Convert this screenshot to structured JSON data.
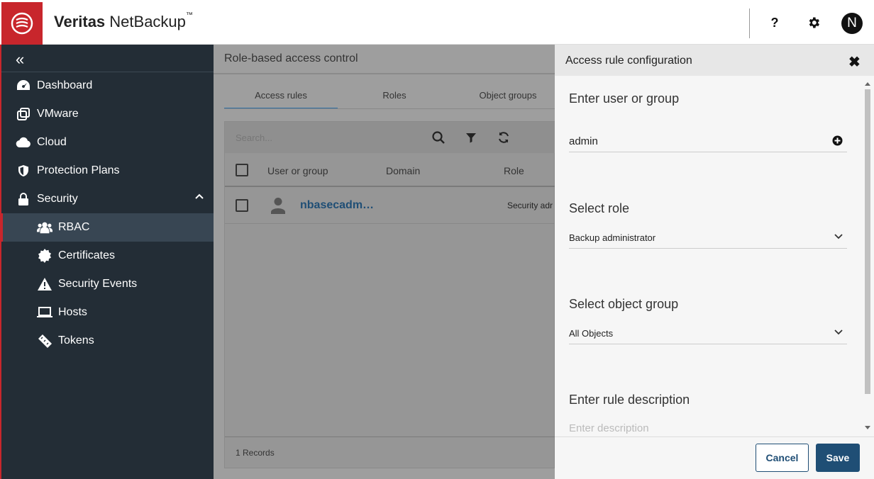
{
  "header": {
    "brand_bold": "Veritas",
    "brand_rest": " NetBackup",
    "trademark": "™",
    "help_label": "?",
    "avatar_initial": "N"
  },
  "sidebar": {
    "items": [
      {
        "label": "Dashboard",
        "icon": "dashboard-icon"
      },
      {
        "label": "VMware",
        "icon": "vmware-icon"
      },
      {
        "label": "Cloud",
        "icon": "cloud-icon"
      },
      {
        "label": "Protection Plans",
        "icon": "shield-icon"
      },
      {
        "label": "Security",
        "icon": "lock-icon"
      },
      {
        "label": "RBAC",
        "icon": "users-icon"
      },
      {
        "label": "Certificates",
        "icon": "certificate-icon"
      },
      {
        "label": "Security Events",
        "icon": "warning-icon"
      },
      {
        "label": "Hosts",
        "icon": "laptop-icon"
      },
      {
        "label": "Tokens",
        "icon": "ticket-icon"
      }
    ]
  },
  "main": {
    "title": "Role-based access control",
    "tabs": [
      {
        "label": "Access rules"
      },
      {
        "label": "Roles"
      },
      {
        "label": "Object groups"
      }
    ],
    "search_placeholder": "Search...",
    "columns": [
      "User or group",
      "Domain",
      "Role"
    ],
    "rows": [
      {
        "user": "nbasecadm…",
        "domain": "",
        "role": "Security adr"
      }
    ],
    "records_text": "1 Records"
  },
  "drawer": {
    "title": "Access rule configuration",
    "user_label": "Enter user or group",
    "user_value": "admin",
    "role_label": "Select role",
    "role_value": "Backup administrator",
    "object_label": "Select object group",
    "object_value": "All Objects",
    "desc_label": "Enter rule description",
    "desc_placeholder": "Enter description",
    "cancel_label": "Cancel",
    "save_label": "Save"
  },
  "colors": {
    "brand_red": "#c8262c",
    "sidebar_bg": "#232d36",
    "primary_blue": "#1f4e75"
  }
}
